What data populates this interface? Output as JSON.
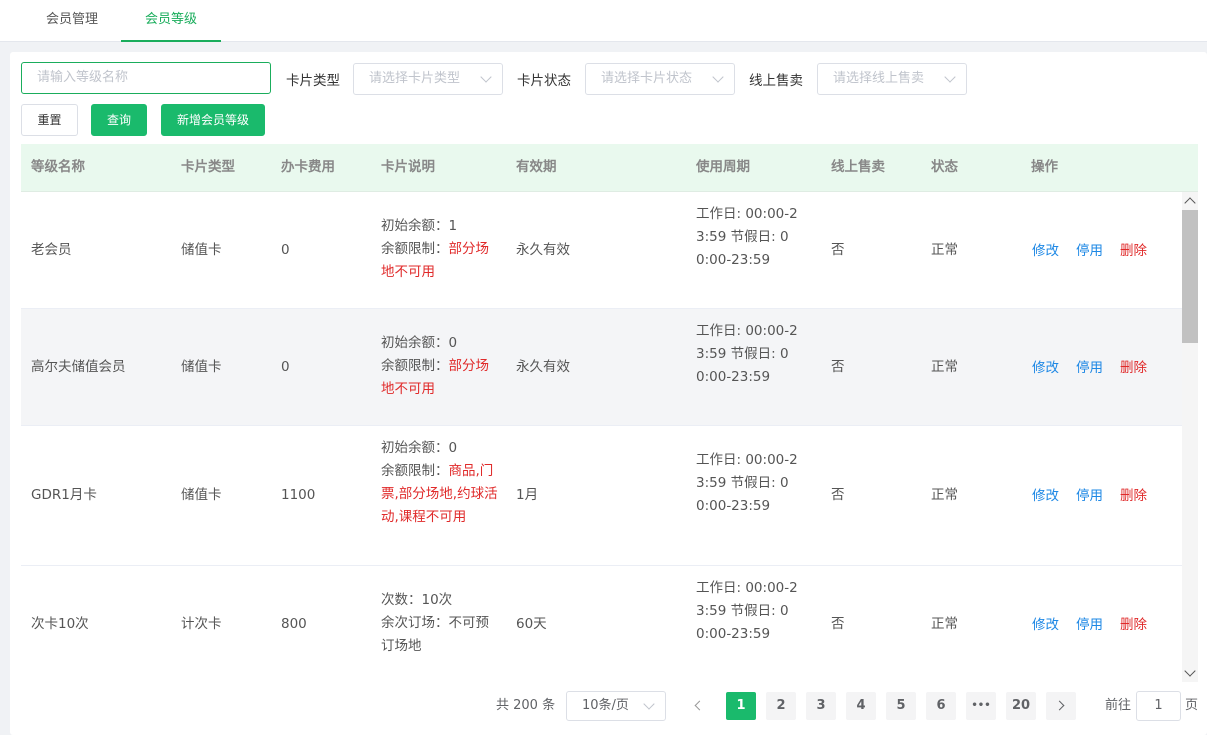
{
  "tabs": [
    {
      "label": "会员管理"
    },
    {
      "label": "会员等级"
    }
  ],
  "filters": {
    "name_placeholder": "请输入等级名称",
    "card_type_label": "卡片类型",
    "card_type_placeholder": "请选择卡片类型",
    "card_status_label": "卡片状态",
    "card_status_placeholder": "请选择卡片状态",
    "online_label": "线上售卖",
    "online_placeholder": "请选择线上售卖"
  },
  "buttons": {
    "reset": "重置",
    "query": "查询",
    "add": "新增会员等级"
  },
  "table": {
    "headers": [
      "等级名称",
      "卡片类型",
      "办卡费用",
      "卡片说明",
      "有效期",
      "使用周期",
      "线上售卖",
      "状态",
      "操作"
    ],
    "actions": {
      "edit": "修改",
      "disable": "停用",
      "delete": "删除"
    },
    "rows": [
      {
        "name": "老会员",
        "type": "储值卡",
        "fee": "0",
        "desc1": "初始余额：1",
        "desc2_label": "余额限制：",
        "desc2_value": "部分场地不可用",
        "validity": "永久有效",
        "cycle": "工作日: 00:00-23:59 节假日: 00:00-23:59",
        "online": "否",
        "status": "正常"
      },
      {
        "name": "高尔夫储值会员",
        "type": "储值卡",
        "fee": "0",
        "desc1": "初始余额：0",
        "desc2_label": "余额限制：",
        "desc2_value": "部分场地不可用",
        "validity": "永久有效",
        "cycle": "工作日: 00:00-23:59 节假日: 00:00-23:59",
        "online": "否",
        "status": "正常"
      },
      {
        "name": "GDR1月卡",
        "type": "储值卡",
        "fee": "1100",
        "desc1": "初始余额：0",
        "desc2_label": "余额限制：",
        "desc2_value": "商品,门票,部分场地,约球活动,课程不可用",
        "validity": "1月",
        "cycle": "工作日: 00:00-23:59 节假日: 00:00-23:59",
        "online": "否",
        "status": "正常"
      },
      {
        "name": "次卡10次",
        "type": "计次卡",
        "fee": "800",
        "desc1": "次数：10次",
        "desc2_label": "余次订场：",
        "desc2_value": "不可预订场地",
        "validity": "60天",
        "cycle": "工作日: 00:00-23:59 节假日: 00:00-23:59",
        "online": "否",
        "status": "正常"
      }
    ]
  },
  "pagination": {
    "total": "共 200 条",
    "page_size": "10条/页",
    "pages": [
      "1",
      "2",
      "3",
      "4",
      "5",
      "6",
      "•••",
      "20"
    ],
    "current_page": "1",
    "goto_label": "前往",
    "goto_value": "1",
    "page_unit": "页"
  },
  "colors": {
    "accent": "#1aba6c",
    "header_bg": "#e9f9ee",
    "link": "#1e88e5",
    "danger": "#e02a2a"
  }
}
